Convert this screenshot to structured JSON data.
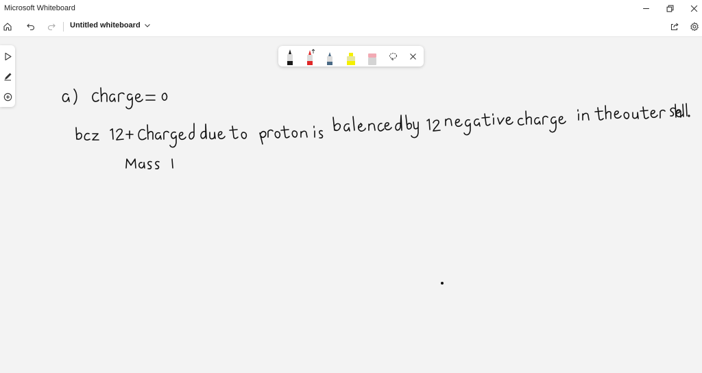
{
  "window": {
    "title": "Microsoft Whiteboard",
    "controls": [
      "minimize-icon",
      "restore-icon",
      "close-icon"
    ]
  },
  "toolbar": {
    "document_title": "Untitled whiteboard",
    "left_icons": [
      "home-icon",
      "undo-icon",
      "redo-icon"
    ],
    "right_icons": [
      "share-icon",
      "settings-icon"
    ]
  },
  "left_rail": {
    "icons": [
      "select-icon",
      "pen-icon",
      "add-icon"
    ]
  },
  "pen_tray": {
    "pens": [
      {
        "name": "black-pen",
        "color": "#1a1a1a"
      },
      {
        "name": "red-pen",
        "color": "#e02828"
      },
      {
        "name": "blue-pen",
        "color": "#4a6a86"
      },
      {
        "name": "yellow-highlighter",
        "color": "#f5f000"
      },
      {
        "name": "eraser",
        "color": "#f2aab4"
      }
    ],
    "tools": [
      "lasso-icon",
      "close-icon"
    ]
  },
  "canvas": {
    "handwriting": [
      "a) charge = 0",
      "bcz 12+ Charged due to proton is balanced by 12 negative charge in the outer shell.",
      "Mass 1"
    ],
    "ink_color": "#111111",
    "background": "#f3f3f3"
  }
}
